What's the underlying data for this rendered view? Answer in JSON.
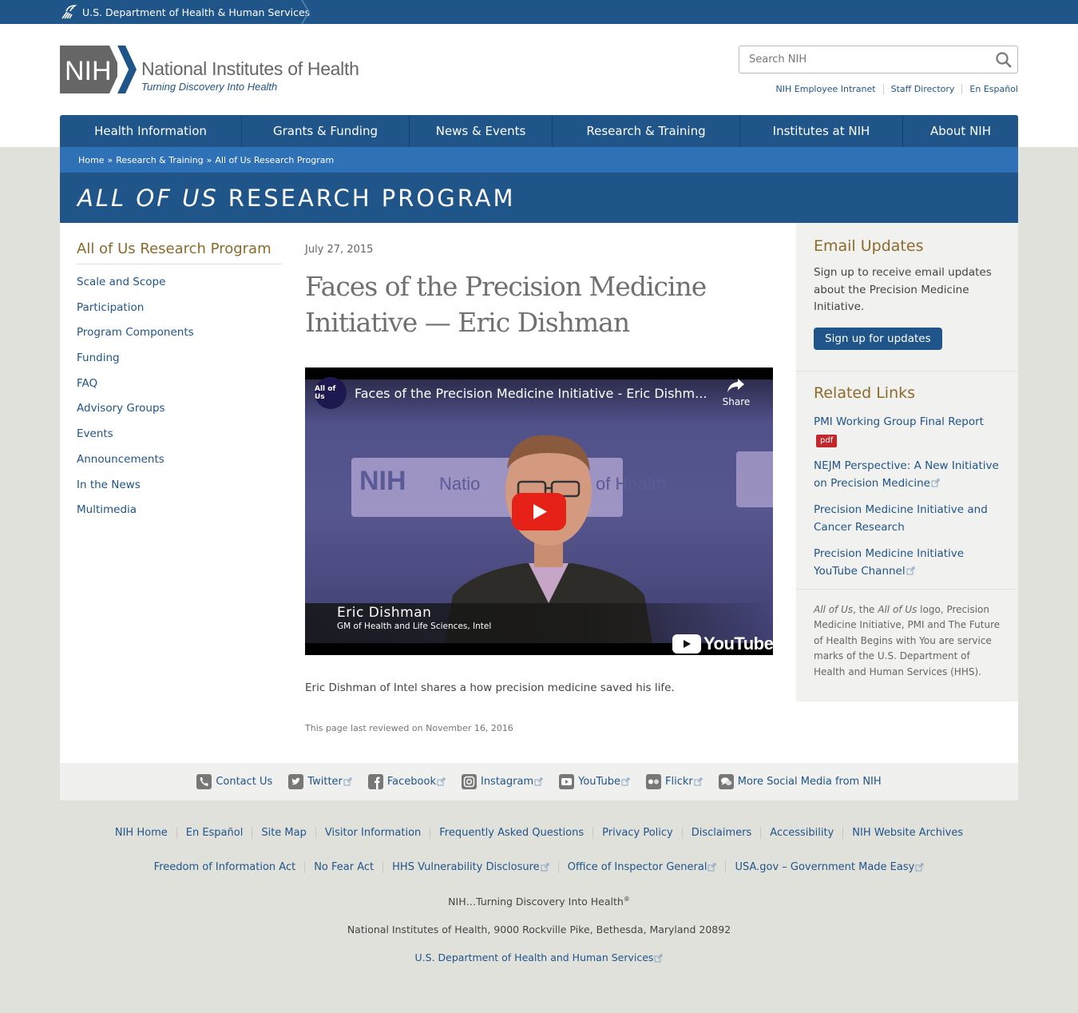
{
  "hhs": {
    "label": "U.S. Department of Health & Human Services"
  },
  "header": {
    "logo_mark": "NIH",
    "logo_title": "National Institutes of Health",
    "logo_tagline": "Turning Discovery Into Health",
    "search_placeholder": "Search NIH",
    "util_links": [
      "NIH Employee Intranet",
      "Staff Directory",
      "En Español"
    ]
  },
  "nav": {
    "items": [
      "Health Information",
      "Grants & Funding",
      "News & Events",
      "Research & Training",
      "Institutes at NIH",
      "About NIH"
    ]
  },
  "breadcrumb": {
    "items": [
      "Home",
      "Research & Training",
      "All of Us Research Program"
    ],
    "separator": "»"
  },
  "banner": {
    "italic": "ALL OF US",
    "rest": "RESEARCH PROGRAM"
  },
  "left_nav": {
    "title": "All of Us Research Program",
    "items": [
      "Scale and Scope",
      "Participation",
      "Program Components",
      "Funding",
      "FAQ",
      "Advisory Groups",
      "Events",
      "Announcements",
      "In the News",
      "Multimedia"
    ]
  },
  "article": {
    "date": "July 27, 2015",
    "headline": "Faces of the Precision Medicine Initiative — Eric Dishman",
    "caption": "Eric Dishman of Intel shares a how precision medicine saved his life.",
    "reviewed": "This page last reviewed on November 16, 2016"
  },
  "video": {
    "channel_badge": "All of Us",
    "title": "Faces of the Precision Medicine Initiative - Eric Dishm...",
    "share_label": "Share",
    "bg_logo": "NIH",
    "bg_text_left": "Natio",
    "bg_text_right": "of Health",
    "person_name": "Eric Dishman",
    "person_role": "GM of Health and Life Sciences, Intel",
    "yt_label": "YouTube"
  },
  "sidebar": {
    "email_title": "Email Updates",
    "email_text": "Sign up to receive email updates about the Precision Medicine Initiative.",
    "email_button": "Sign up for updates",
    "related_title": "Related Links",
    "related_links": [
      "PMI Working Group Final Report",
      "NEJM Perspective: A New Initiative on Precision Medicine",
      "Precision Medicine Initiative and Cancer Research",
      "Precision Medicine Initiative YouTube Channel"
    ],
    "pdf_badge": "pdf",
    "legal_1": "All of Us",
    "legal_2": ", the ",
    "legal_3": "All of Us",
    "legal_4": " logo, Precision Medicine Initiative, PMI and The Future of Health Begins with You are service marks of the U.S. Department of Health and Human Services (HHS)."
  },
  "social": {
    "items": [
      "Contact Us",
      "Twitter",
      "Facebook",
      "Instagram",
      "YouTube",
      "Flickr",
      "More Social Media from NIH"
    ]
  },
  "footer": {
    "row1": [
      "NIH Home",
      "En Español",
      "Site Map",
      "Visitor Information",
      "Frequently Asked Questions",
      "Privacy Policy",
      "Disclaimers",
      "Accessibility",
      "NIH Website Archives"
    ],
    "row2": [
      "Freedom of Information Act",
      "No Fear Act",
      "HHS Vulnerability Disclosure",
      "Office of Inspector General",
      "USA.gov – Government Made Easy"
    ],
    "tagline": "NIH…Turning Discovery Into Health",
    "tagline_mark": "®",
    "address": "National Institutes of Health, 9000 Rockville Pike, Bethesda, Maryland 20892",
    "hhs_link": "U.S. Department of Health and Human Services"
  },
  "colors": {
    "brand_blue": "#20558a",
    "accent_gold": "#8b6a2a",
    "pdf_red": "#c1272d"
  }
}
